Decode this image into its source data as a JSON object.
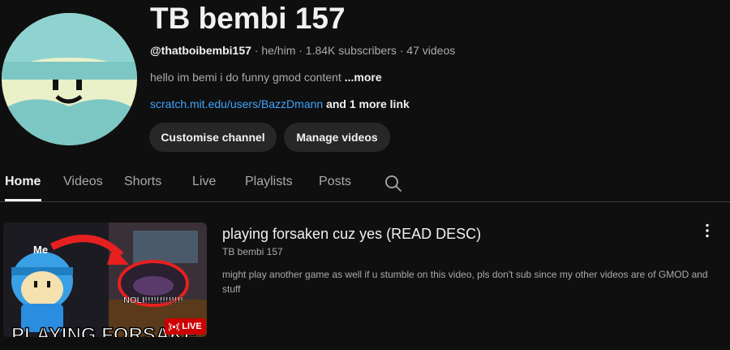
{
  "channel": {
    "name": "TB bembi 157",
    "handle": "@thatboibembi157",
    "meta_rest": " · he/him · 1.84K subscribers · 47 videos",
    "description": "hello im bemi i do funny gmod content ",
    "more_label": "...more",
    "link": "scratch.mit.edu/users/BazzDmann",
    "extra_links": " and 1 more link"
  },
  "buttons": {
    "customise": "Customise channel",
    "manage": "Manage videos"
  },
  "tabs": [
    "Home",
    "Videos",
    "Shorts",
    "Live",
    "Playlists",
    "Posts"
  ],
  "active_tab": "Home",
  "featured_video": {
    "title": "playing forsaken cuz yes (READ DESC)",
    "channel": "TB bembi 157",
    "description": "might play another game as well if u stumble on this video, pls don't sub since my other videos are of GMOD and stuff",
    "badge": "LIVE",
    "thumbnail_text": {
      "me": "Me",
      "noli": "NOLI!!!!!!!!!!!!!",
      "caption": "PLAYING FORSAKE"
    }
  },
  "icons": [
    "search-icon",
    "kebab-menu-icon",
    "live-broadcast-icon"
  ],
  "colors": {
    "background": "#0f0f0f",
    "link": "#3ea6ff",
    "live": "#cc0000",
    "button": "#272727"
  }
}
